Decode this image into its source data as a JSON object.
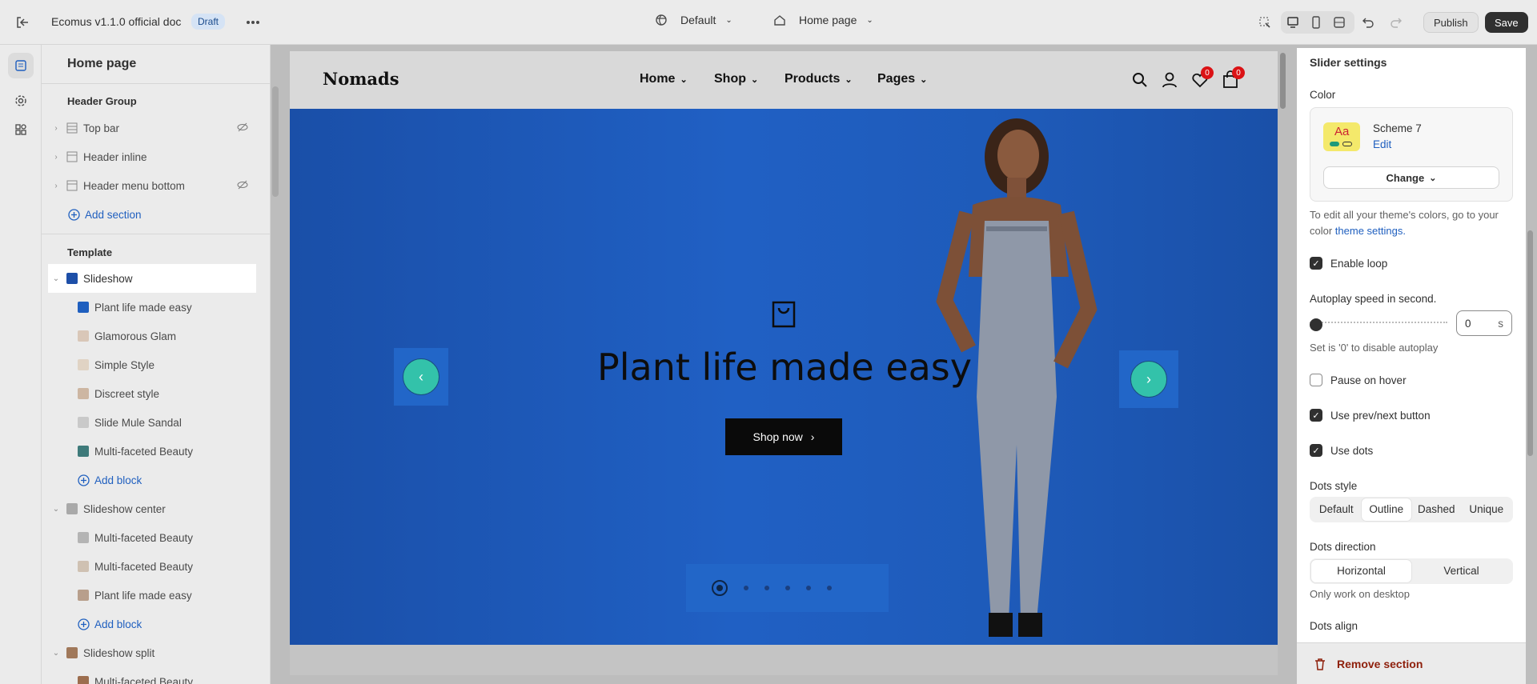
{
  "topbar": {
    "title": "Ecomus v1.1.0 official doc",
    "status_badge": "Draft",
    "theme_selector": "Default",
    "page_selector": "Home page",
    "publish_label": "Publish",
    "save_label": "Save"
  },
  "sidebar": {
    "title": "Home page",
    "header_group_label": "Header Group",
    "header_sections": [
      {
        "label": "Top bar",
        "icon": "section-icon"
      },
      {
        "label": "Header inline",
        "icon": "header-icon"
      },
      {
        "label": "Header menu bottom",
        "icon": "header-icon"
      }
    ],
    "add_section_label": "Add section",
    "template_label": "Template",
    "slideshow": {
      "label": "Slideshow",
      "blocks": [
        "Plant life made easy",
        "Glamorous Glam",
        "Simple Style",
        "Discreet style",
        "Slide Mule Sandal",
        "Multi-faceted Beauty"
      ],
      "add_block_label": "Add block"
    },
    "slideshow_center": {
      "label": "Slideshow center",
      "blocks": [
        "Multi-faceted Beauty",
        "Multi-faceted Beauty",
        "Plant life made easy"
      ],
      "add_block_label": "Add block"
    },
    "slideshow_split": {
      "label": "Slideshow split",
      "blocks": [
        "Multi-faceted Beauty"
      ]
    }
  },
  "preview": {
    "logo": "Nomads",
    "nav": [
      "Home",
      "Shop",
      "Products",
      "Pages"
    ],
    "wishlist_count": "0",
    "cart_count": "0",
    "hero_title": "Plant life made easy",
    "hero_button": "Shop now",
    "prev_arrow": "‹",
    "next_arrow": "›"
  },
  "panel": {
    "title": "Slider settings",
    "color_label": "Color",
    "scheme_swatch_text": "Aa",
    "scheme_name": "Scheme 7",
    "scheme_edit": "Edit",
    "change_label": "Change",
    "color_help_prefix": "To edit all your theme's colors, go to your color ",
    "color_help_link": "theme settings.",
    "enable_loop": "Enable loop",
    "autoplay_label": "Autoplay speed in second.",
    "autoplay_value": "0",
    "autoplay_unit": "s",
    "autoplay_help": "Set is '0' to disable autoplay",
    "pause_on_hover": "Pause on hover",
    "use_prev_next": "Use prev/next button",
    "use_dots": "Use dots",
    "dots_style_label": "Dots style",
    "dots_style_options": [
      "Default",
      "Outline",
      "Dashed",
      "Unique"
    ],
    "dots_direction_label": "Dots direction",
    "dots_direction_options": [
      "Horizontal",
      "Vertical"
    ],
    "dots_direction_help": "Only work on desktop",
    "dots_align_label": "Dots align",
    "remove_section": "Remove section"
  }
}
